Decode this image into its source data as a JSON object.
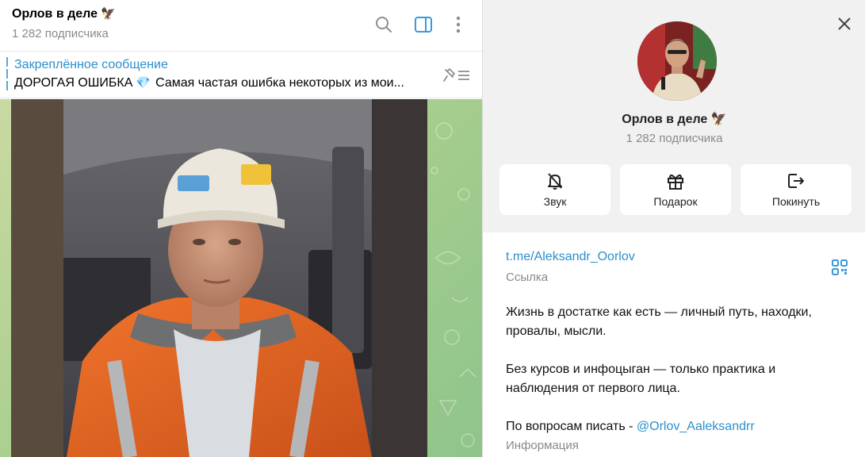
{
  "chat": {
    "title": "Орлов в деле",
    "title_emoji": "🦅",
    "subscribers": "1 282 подписчика",
    "icons": [
      "search-icon",
      "side-panel-icon",
      "more-vertical-icon"
    ]
  },
  "pinned": {
    "label": "Закреплённое сообщение",
    "text_prefix": "ДОРОГАЯ ОШИБКА",
    "gem": "💎",
    "text": "Самая частая ошибка некоторых из мои..."
  },
  "info": {
    "name": "Орлов в деле",
    "name_emoji": "🦅",
    "subscribers": "1 282 подписчика",
    "actions": [
      {
        "label": "Звук",
        "icon": "bell-off-icon"
      },
      {
        "label": "Подарок",
        "icon": "gift-icon"
      },
      {
        "label": "Покинуть",
        "icon": "leave-icon"
      }
    ],
    "link": "t.me/Aleksandr_Oorlov",
    "link_caption": "Ссылка",
    "desc_line1": "Жизнь в достатке как есть — личный путь, находки,",
    "desc_line2": "провалы, мысли.",
    "desc_line3": "Без курсов и инфоцыган — только практика и",
    "desc_line4": "наблюдения от первого лица.",
    "contact_prefix": "По вопросам писать - ",
    "contact_handle": "@Orlov_Aaleksandrr",
    "info_caption": "Информация"
  },
  "colors": {
    "accent": "#2c8fcb",
    "muted": "#8a8a8a",
    "panel_bg": "#f1f1f1"
  }
}
